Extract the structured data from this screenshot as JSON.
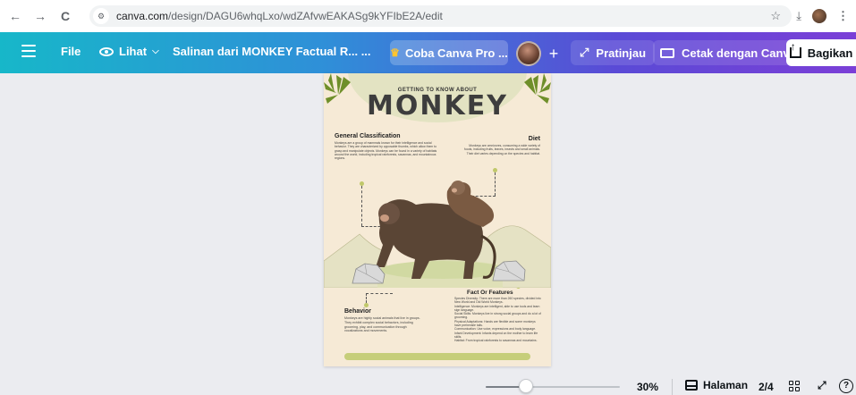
{
  "browser": {
    "url_host": "canva.com",
    "url_path": "/design/DAGU6whqLxo/wdZAfvwEAKASg9kYFIbE2A/edit",
    "back_icon": "←",
    "forward_icon": "→",
    "reload_icon": "C",
    "star_icon": "☆",
    "download_icon": "⤓",
    "menu_icon": "⋮"
  },
  "toolbar": {
    "file_label": "File",
    "view_label": "Lihat",
    "chevron": "⌵",
    "title": "Salinan dari MONKEY Factual R... ...",
    "pro_label": "Coba Canva Pro ...",
    "plus_label": "+",
    "preview_label": "Pratinjau",
    "print_label": "Cetak dengan Canva",
    "share_label": "Bagikan"
  },
  "poster": {
    "kicker": "GETTING TO KNOW ABOUT",
    "headline": "MONKEY",
    "general_title": "General Classification",
    "general_body": "Monkeys are a group of mammals known for their intelligence and social behavior. They are characterized by opposable thumbs, which allow them to grasp and manipulate objects. Monkeys can be found in a variety of habitats around the world, including tropical rainforests, savannas, and mountainous regions.",
    "diet_title": "Diet",
    "diet_body": "Monkeys are omnivores, consuming a wide variety of foods, including fruits, leaves, insects and small animals. Their diet varies depending on the species and habitat.",
    "behavior_title": "Behavior",
    "behavior_body": "Monkeys are highly social animals that live in groups. They exhibit complex social behaviors, including grooming, play, and communication through vocalizations and movements.",
    "fact_title": "Fact Or Features",
    "facts": [
      "Species Diversity: There are more than 260 species, divided into New World and Old World Monkeys.",
      "Intelligence: Monkeys are intelligent, able to use tools and learn sign language.",
      "Social Skills: Monkeys live in strong social groups and do a lot of grooming.",
      "Physical Adaptations: Hands are flexible and some monkeys have prehensile tails.",
      "Communication: Use voice, expressions and body language.",
      "Infant Development: Infants depend on the mother to learn life skills.",
      "Habitat: From tropical rainforests to savannas and mountains."
    ]
  },
  "status": {
    "zoom_value": "30%",
    "zoom_level": 0.3,
    "pages_label": "Halaman",
    "page_count": "2/4",
    "expand_icon": "⤢",
    "help_icon": "?"
  }
}
